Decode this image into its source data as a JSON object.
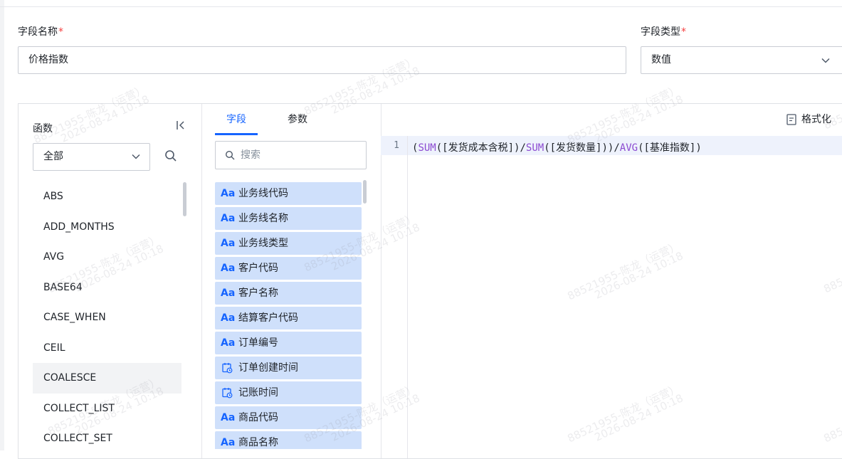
{
  "form": {
    "field_name_label": "字段名称",
    "field_name_value": "价格指数",
    "field_type_label": "字段类型",
    "field_type_value": "数值",
    "required_mark": "*"
  },
  "functions": {
    "title": "函数",
    "category_selected": "全部",
    "items": [
      "ABS",
      "ADD_MONTHS",
      "AVG",
      "BASE64",
      "CASE_WHEN",
      "CEIL",
      "COALESCE",
      "COLLECT_LIST",
      "COLLECT_SET"
    ]
  },
  "fields_panel": {
    "tabs": [
      "字段",
      "参数"
    ],
    "active_tab": "字段",
    "search_placeholder": "搜索",
    "items": [
      {
        "label": "业务线代码",
        "type_icon": "text-type-icon",
        "type_glyph": "Aa"
      },
      {
        "label": "业务线名称",
        "type_icon": "text-type-icon",
        "type_glyph": "Aa"
      },
      {
        "label": "业务线类型",
        "type_icon": "text-type-icon",
        "type_glyph": "Aa"
      },
      {
        "label": "客户代码",
        "type_icon": "text-type-icon",
        "type_glyph": "Aa"
      },
      {
        "label": "客户名称",
        "type_icon": "text-type-icon",
        "type_glyph": "Aa"
      },
      {
        "label": "结算客户代码",
        "type_icon": "text-type-icon",
        "type_glyph": "Aa"
      },
      {
        "label": "订单编号",
        "type_icon": "text-type-icon",
        "type_glyph": "Aa"
      },
      {
        "label": "订单创建时间",
        "type_icon": "datetime-type-icon",
        "type_glyph": ""
      },
      {
        "label": "记账时间",
        "type_icon": "datetime-type-icon",
        "type_glyph": ""
      },
      {
        "label": "商品代码",
        "type_icon": "text-type-icon",
        "type_glyph": "Aa"
      },
      {
        "label": "商品名称",
        "type_icon": "text-type-icon",
        "type_glyph": "Aa"
      }
    ]
  },
  "editor": {
    "format_label": "格式化",
    "line_number": "1",
    "code": {
      "p1": "(",
      "fn1": "SUM",
      "p2": "([发货成本含税])/",
      "fn2": "SUM",
      "p3": "([发货数量]))/",
      "fn3": "AVG",
      "p4": "([基准指数])"
    }
  },
  "watermark": {
    "line1": "88521955-陈龙（运营）",
    "line2": "2026-08-24 10:18"
  },
  "colors": {
    "accent": "#1664ff",
    "field_item_bg": "#cfe0fb",
    "keyword": "#8c4bd1",
    "required": "#f53f3f"
  }
}
